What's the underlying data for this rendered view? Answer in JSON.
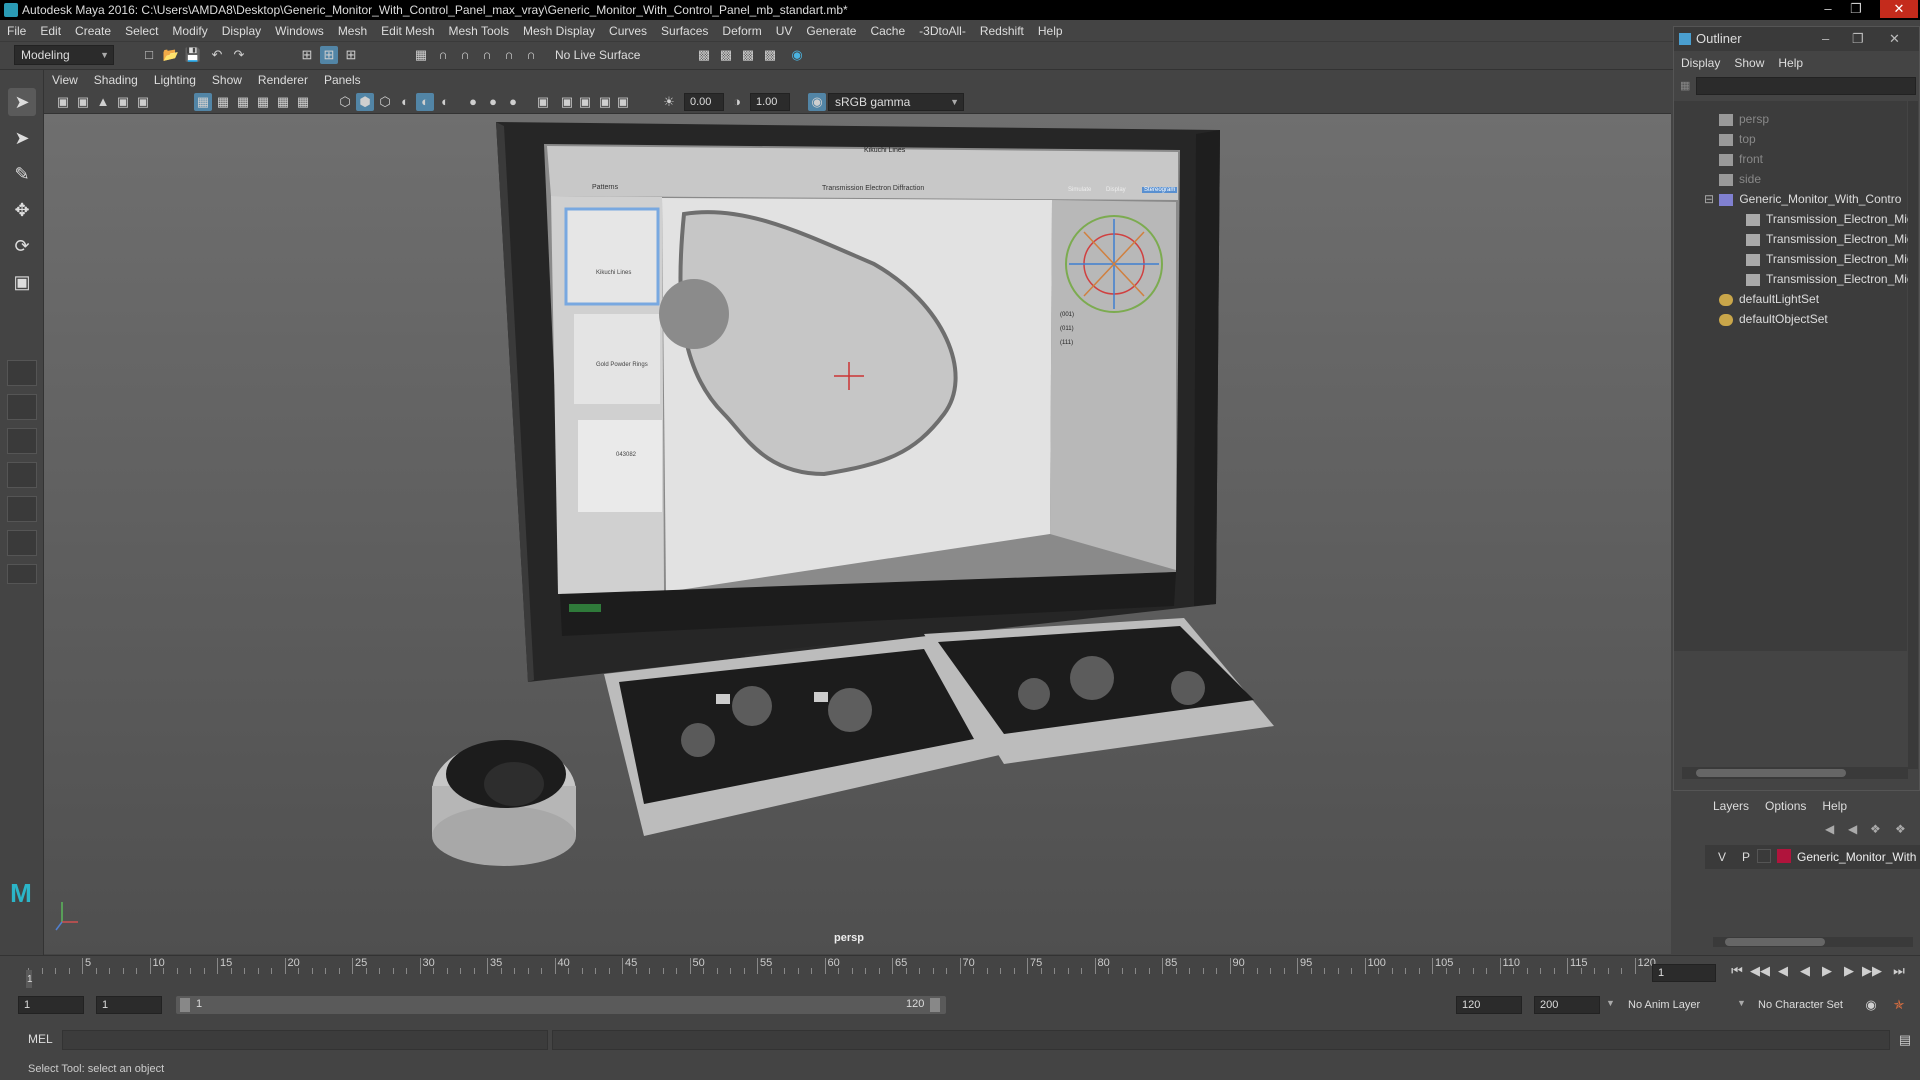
{
  "window": {
    "title": "Autodesk Maya 2016: C:\\Users\\AMDA8\\Desktop\\Generic_Monitor_With_Control_Panel_max_vray\\Generic_Monitor_With_Control_Panel_mb_standart.mb*"
  },
  "menubar": [
    "File",
    "Edit",
    "Create",
    "Select",
    "Modify",
    "Display",
    "Windows",
    "Mesh",
    "Edit Mesh",
    "Mesh Tools",
    "Mesh Display",
    "Curves",
    "Surfaces",
    "Deform",
    "UV",
    "Generate",
    "Cache",
    "-3DtoAll-",
    "Redshift",
    "Help"
  ],
  "shelf": {
    "mode": "Modeling",
    "live_surface": "No Live Surface"
  },
  "viewport_menu": [
    "View",
    "Shading",
    "Lighting",
    "Show",
    "Renderer",
    "Panels"
  ],
  "viewport_toolbar": {
    "exposure": "0.00",
    "gamma": "1.00",
    "color_space": "sRGB gamma"
  },
  "viewport": {
    "camera": "persp",
    "screen": {
      "window_title": "Kikuchi Lines",
      "panel_title": "Patterns",
      "center_title": "Transmission Electron Diffraction",
      "tabs": [
        "Simulate",
        "Display",
        "Stereogram"
      ],
      "thumbs": [
        "Kikuchi Lines",
        "Gold Powder Rings",
        "043082"
      ],
      "indices": [
        "(001)",
        "(011)",
        "(111)"
      ]
    }
  },
  "outliner": {
    "title": "Outliner",
    "menu": [
      "Display",
      "Show",
      "Help"
    ],
    "items": [
      {
        "label": "persp",
        "dim": true,
        "indent": 1,
        "icon": "camera"
      },
      {
        "label": "top",
        "dim": true,
        "indent": 1,
        "icon": "camera"
      },
      {
        "label": "front",
        "dim": true,
        "indent": 1,
        "icon": "camera"
      },
      {
        "label": "side",
        "dim": true,
        "indent": 1,
        "icon": "camera"
      },
      {
        "label": "Generic_Monitor_With_Contro",
        "dim": false,
        "indent": 1,
        "icon": "group"
      },
      {
        "label": "Transmission_Electron_Mic",
        "dim": false,
        "indent": 2,
        "icon": "mesh"
      },
      {
        "label": "Transmission_Electron_Mic",
        "dim": false,
        "indent": 2,
        "icon": "mesh"
      },
      {
        "label": "Transmission_Electron_Mic",
        "dim": false,
        "indent": 2,
        "icon": "mesh"
      },
      {
        "label": "Transmission_Electron_Mic",
        "dim": false,
        "indent": 2,
        "icon": "mesh"
      },
      {
        "label": "defaultLightSet",
        "dim": false,
        "indent": 1,
        "icon": "set"
      },
      {
        "label": "defaultObjectSet",
        "dim": false,
        "indent": 1,
        "icon": "set"
      }
    ]
  },
  "layers": {
    "menu": [
      "Layers",
      "Options",
      "Help"
    ],
    "row": {
      "v": "V",
      "p": "P",
      "name": "Generic_Monitor_With",
      "color": "#b0143c"
    }
  },
  "timeline": {
    "ticks": [
      "5",
      "10",
      "15",
      "20",
      "25",
      "30",
      "35",
      "40",
      "45",
      "50",
      "55",
      "60",
      "65",
      "70",
      "75",
      "80",
      "85",
      "90",
      "95",
      "100",
      "105",
      "110",
      "115",
      "120"
    ],
    "current_frame": "1",
    "current_marker": "1"
  },
  "range": {
    "start": "1",
    "playback_start": "1",
    "slider_start": "1",
    "slider_end": "120",
    "playback_end": "120",
    "end": "200",
    "anim_layer": "No Anim Layer",
    "character_set": "No Character Set"
  },
  "cmdline": {
    "label": "MEL"
  },
  "status": {
    "help": "Select Tool: select an object"
  },
  "colors": {
    "accent": "#5285a6",
    "layer": "#b0143c"
  }
}
